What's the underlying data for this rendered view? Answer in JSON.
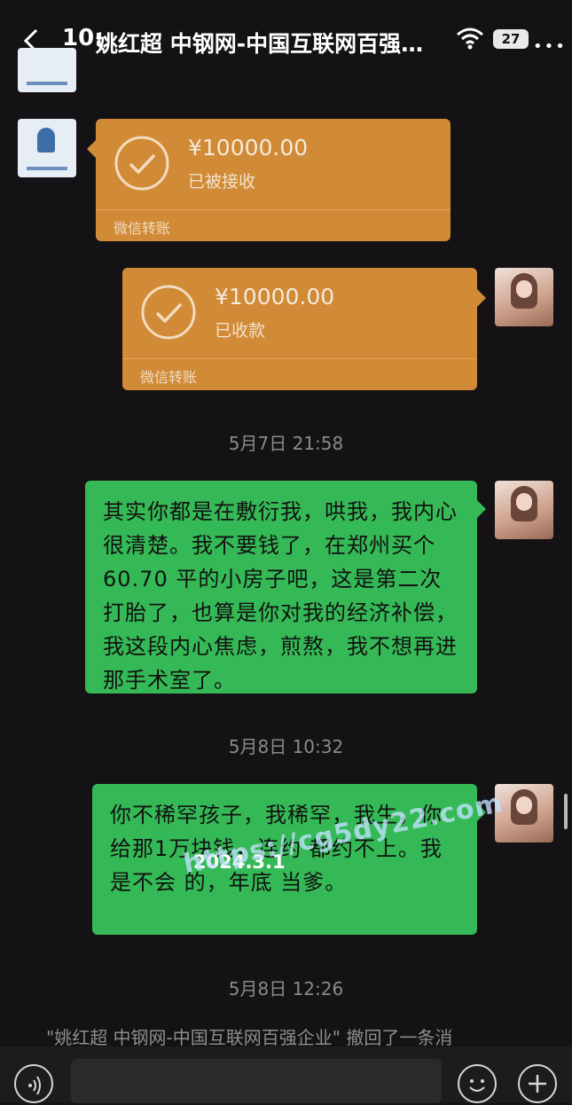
{
  "header": {
    "time": "10:",
    "chat_title": "姚红超 中钢网-中国互联网百强…",
    "battery": "27"
  },
  "messages": {
    "transfer_received": {
      "amount": "¥10000.00",
      "status": "已被接收",
      "label": "微信转账"
    },
    "transfer_collected": {
      "amount": "¥10000.00",
      "status": "已收款",
      "label": "微信转账"
    },
    "timestamp_1": "5月7日 21:58",
    "message_1": "其实你都是在敷衍我，哄我，我内心很清楚。我不要钱了，在郑州买个 60.70 平的小房子吧，这是第二次打胎了，也算是你对我的经济补偿，我这段内心焦虑，煎熬，我不想再进那手术室了。",
    "timestamp_2": "5月8日 10:32",
    "message_2": "你不稀罕孩子，我稀罕，我生，你给那1万块钱，连约 都约不上。我是不会 的，年底 当爹。",
    "timestamp_3": "5月8日 12:26",
    "recall_notice": "\"姚红超 中钢网-中国互联网百强企业\" 撤回了一条消"
  },
  "watermark": {
    "date": "2024.3.1",
    "url": "https://cg5dy22.com"
  },
  "colors": {
    "background": "#141214",
    "transfer_bubble": "#d18a36",
    "sent_bubble": "#35b956"
  },
  "icons": {
    "back": "chevron-left-icon",
    "wifi": "wifi-icon",
    "more": "more-icon",
    "check": "check-circle-icon",
    "voice": "voice-icon",
    "emoji": "emoji-icon",
    "plus": "plus-icon"
  }
}
